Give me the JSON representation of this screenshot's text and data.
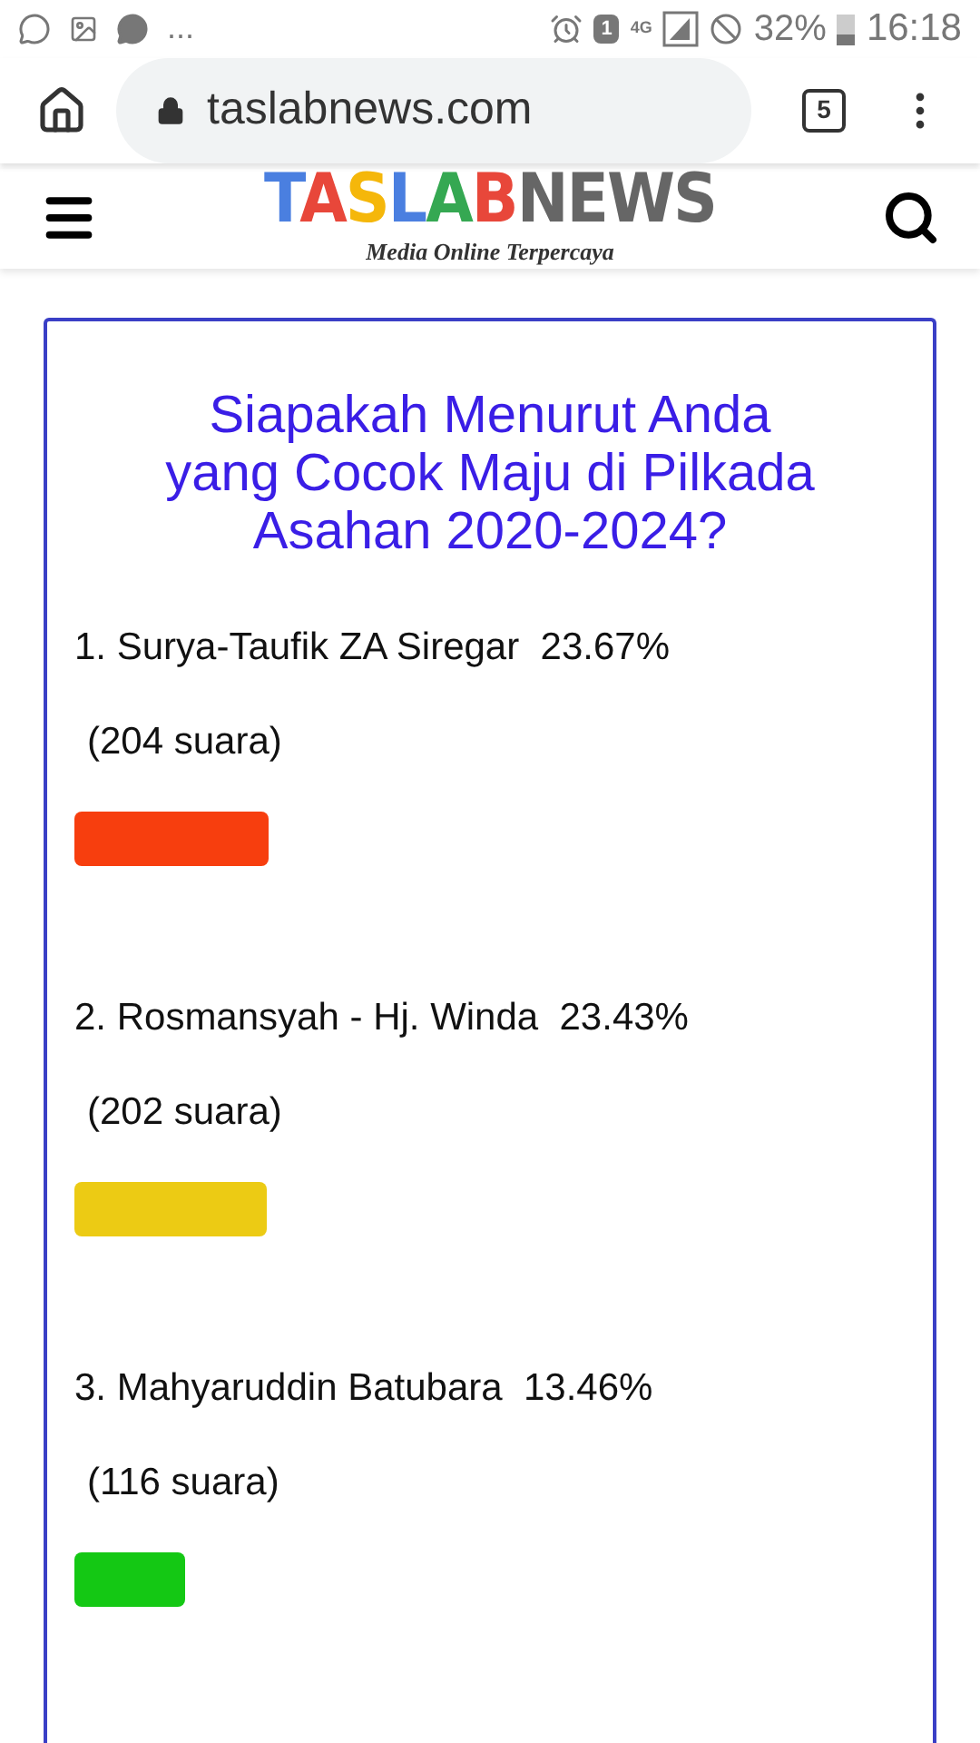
{
  "status_bar": {
    "overflow": "...",
    "sim": "1",
    "network": "4G",
    "battery": "32%",
    "time": "16:18"
  },
  "browser": {
    "url": "taslabnews.com",
    "tab_count": "5"
  },
  "site_header": {
    "logo_parts": [
      {
        "text": "T",
        "color": "#4a7fe0"
      },
      {
        "text": "A",
        "color": "#e8473a"
      },
      {
        "text": "S",
        "color": "#f5b70a"
      },
      {
        "text": "L",
        "color": "#4a7fe0"
      },
      {
        "text": "A",
        "color": "#35a852"
      },
      {
        "text": "B",
        "color": "#e8473a"
      },
      {
        "text": "NEWS",
        "color": "#666666"
      }
    ],
    "tagline": "Media Online Terpercaya"
  },
  "poll": {
    "title": "Siapakah Menurut Anda yang Cocok Maju di Pilkada Asahan 2020-2024?",
    "options": [
      {
        "label": "1. Surya-Taufik ZA Siregar",
        "percent": "23.67%",
        "votes": "(204 suara)",
        "color": "#f73e0e"
      },
      {
        "label": "2. Rosmansyah - Hj. Winda",
        "percent": "23.43%",
        "votes": "(202 suara)",
        "color": "#eccb14"
      },
      {
        "label": "3. Mahyaruddin Batubara",
        "percent": "13.46%",
        "votes": "(116 suara)",
        "color": "#14c814"
      }
    ]
  }
}
